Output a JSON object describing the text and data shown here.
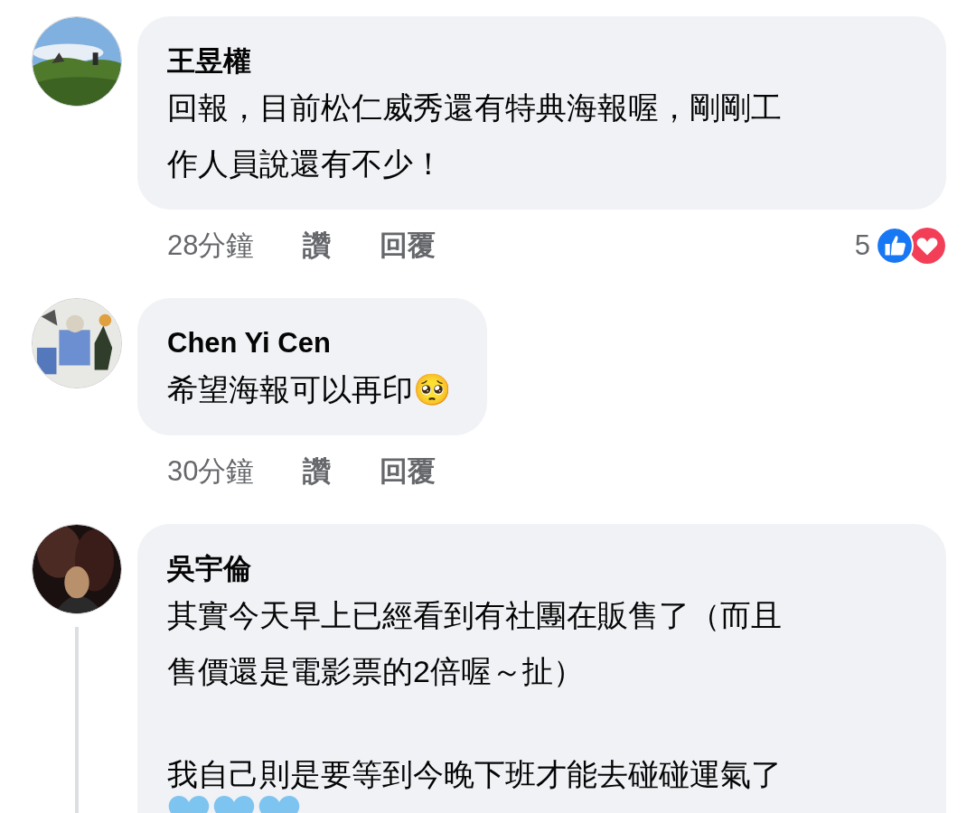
{
  "comments": [
    {
      "kind": "text",
      "author": "王昱權",
      "paragraphs": [
        [
          "回報，目前松仁威秀還有特典海報喔，剛剛工",
          "作人員說還有不少！"
        ]
      ],
      "time": "28分鐘",
      "actions": [
        "讚",
        "回覆"
      ],
      "reactions": {
        "count": "5"
      },
      "avatar": {
        "kind": "picture"
      },
      "thread": false
    },
    {
      "kind": "text",
      "author": "Chen Yi Cen",
      "paragraphs": [
        [
          "希望海報可以再印🥺"
        ]
      ],
      "time": "30分鐘",
      "actions": [
        "讚",
        "回覆"
      ],
      "avatar": {
        "kind": "picture"
      },
      "thread": false
    },
    {
      "kind": "text_hearts",
      "author": "吳宇倫",
      "paragraphs": [
        [
          "其實今天早上已經看到有社團在販售了（而且",
          "售價還是電影票的2倍喔～扯）"
        ],
        [
          "我自己則是要等到今晚下班才能去碰碰運氣了"
        ]
      ],
      "avatar": {
        "kind": "picture"
      },
      "thread": true
    }
  ]
}
